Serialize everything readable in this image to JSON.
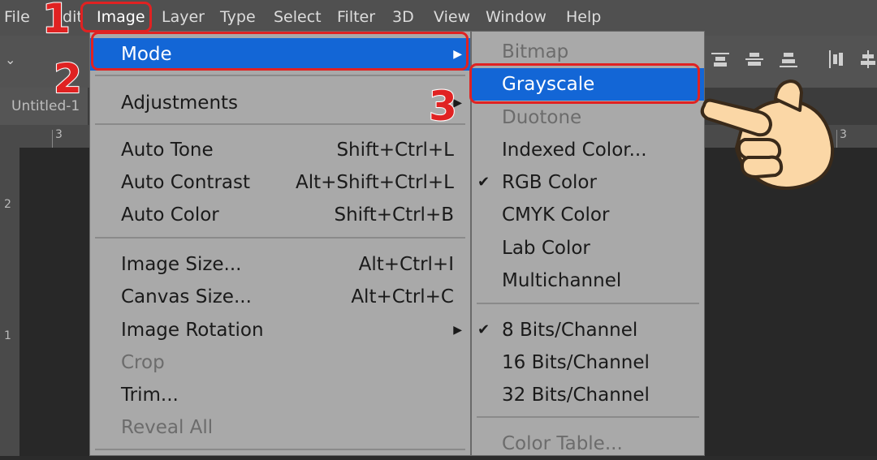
{
  "menubar": {
    "items": [
      "File",
      "Edit",
      "Image",
      "Layer",
      "Type",
      "Select",
      "Filter",
      "3D",
      "View",
      "Window",
      "Help"
    ],
    "active": "Image"
  },
  "steps": [
    "1",
    "2",
    "3"
  ],
  "document": {
    "tab_title": "Untitled-1"
  },
  "rulers": {
    "h_labels": [
      "3",
      "3"
    ],
    "v_labels": [
      "2",
      "1"
    ]
  },
  "image_menu": {
    "items": [
      {
        "label": "Mode",
        "shortcut": "",
        "submenu": true,
        "highlighted": true,
        "disabled": false
      },
      {
        "label": "Adjustments",
        "shortcut": "",
        "submenu": true,
        "highlighted": false,
        "disabled": false
      },
      {
        "label": "Auto Tone",
        "shortcut": "Shift+Ctrl+L",
        "submenu": false,
        "highlighted": false,
        "disabled": false
      },
      {
        "label": "Auto Contrast",
        "shortcut": "Alt+Shift+Ctrl+L",
        "submenu": false,
        "highlighted": false,
        "disabled": false
      },
      {
        "label": "Auto Color",
        "shortcut": "Shift+Ctrl+B",
        "submenu": false,
        "highlighted": false,
        "disabled": false
      },
      {
        "label": "Image Size...",
        "shortcut": "Alt+Ctrl+I",
        "submenu": false,
        "highlighted": false,
        "disabled": false
      },
      {
        "label": "Canvas Size...",
        "shortcut": "Alt+Ctrl+C",
        "submenu": false,
        "highlighted": false,
        "disabled": false
      },
      {
        "label": "Image Rotation",
        "shortcut": "",
        "submenu": true,
        "highlighted": false,
        "disabled": false
      },
      {
        "label": "Crop",
        "shortcut": "",
        "submenu": false,
        "highlighted": false,
        "disabled": true
      },
      {
        "label": "Trim...",
        "shortcut": "",
        "submenu": false,
        "highlighted": false,
        "disabled": false
      },
      {
        "label": "Reveal All",
        "shortcut": "",
        "submenu": false,
        "highlighted": false,
        "disabled": true
      }
    ]
  },
  "mode_submenu": {
    "items": [
      {
        "label": "Bitmap",
        "checked": false,
        "highlighted": false,
        "disabled": true
      },
      {
        "label": "Grayscale",
        "checked": false,
        "highlighted": true,
        "disabled": false
      },
      {
        "label": "Duotone",
        "checked": false,
        "highlighted": false,
        "disabled": true
      },
      {
        "label": "Indexed Color...",
        "checked": false,
        "highlighted": false,
        "disabled": false
      },
      {
        "label": "RGB Color",
        "checked": true,
        "highlighted": false,
        "disabled": false
      },
      {
        "label": "CMYK Color",
        "checked": false,
        "highlighted": false,
        "disabled": false
      },
      {
        "label": "Lab Color",
        "checked": false,
        "highlighted": false,
        "disabled": false
      },
      {
        "label": "Multichannel",
        "checked": false,
        "highlighted": false,
        "disabled": false
      },
      {
        "label": "8 Bits/Channel",
        "checked": true,
        "highlighted": false,
        "disabled": false
      },
      {
        "label": "16 Bits/Channel",
        "checked": false,
        "highlighted": false,
        "disabled": false
      },
      {
        "label": "32 Bits/Channel",
        "checked": false,
        "highlighted": false,
        "disabled": false
      },
      {
        "label": "Color Table...",
        "checked": false,
        "highlighted": false,
        "disabled": true
      }
    ]
  },
  "colors": {
    "highlight": "#1366d6",
    "annotation_red": "#e02222",
    "menu_bg": "#a9a9a9"
  }
}
